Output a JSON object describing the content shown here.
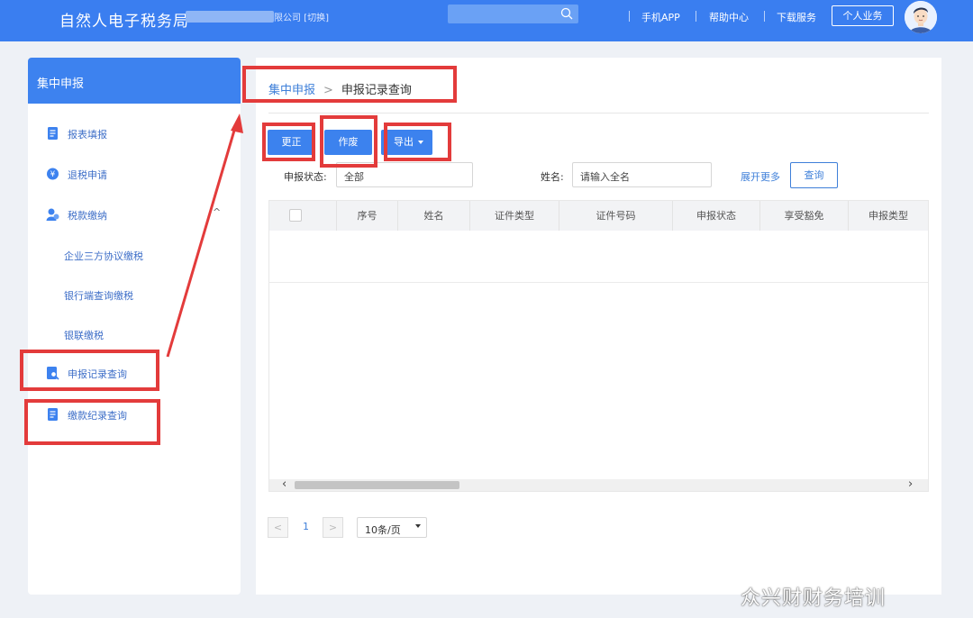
{
  "topbar": {
    "brand": "自然人电子税务局",
    "company_suffix": "限公司 [切换]",
    "nav": [
      "手机APP",
      "帮助中心",
      "下载服务"
    ],
    "personal_button": "个人业务",
    "accent_color": "#3a7ef0"
  },
  "sidebar": {
    "header": "集中申报",
    "items": [
      {
        "label": "报表填报",
        "icon": "document-icon"
      },
      {
        "label": "退税申请",
        "icon": "refund-icon"
      },
      {
        "label": "税款缴纳",
        "icon": "payment-icon"
      },
      {
        "label": "申报记录查询",
        "icon": "search-document-icon"
      },
      {
        "label": "缴款纪录查询",
        "icon": "document-icon"
      }
    ],
    "subitems": [
      "企业三方协议缴税",
      "银行端查询缴税",
      "银联缴税"
    ]
  },
  "breadcrumb": {
    "parent": "集中申报",
    "current": "申报记录查询"
  },
  "toolbar": {
    "correct": "更正",
    "void": "作废",
    "export": "导出"
  },
  "filters": {
    "status_label": "申报状态:",
    "status_value": "全部",
    "name_label": "姓名:",
    "name_placeholder": "请输入全名",
    "expand_more": "展开更多",
    "query_button": "查询"
  },
  "table": {
    "columns": [
      "序号",
      "姓名",
      "证件类型",
      "证件号码",
      "申报状态",
      "享受豁免",
      "申报类型"
    ]
  },
  "pagination": {
    "page": "1",
    "page_size": "10条/页"
  },
  "watermark": "众兴财财务培训"
}
